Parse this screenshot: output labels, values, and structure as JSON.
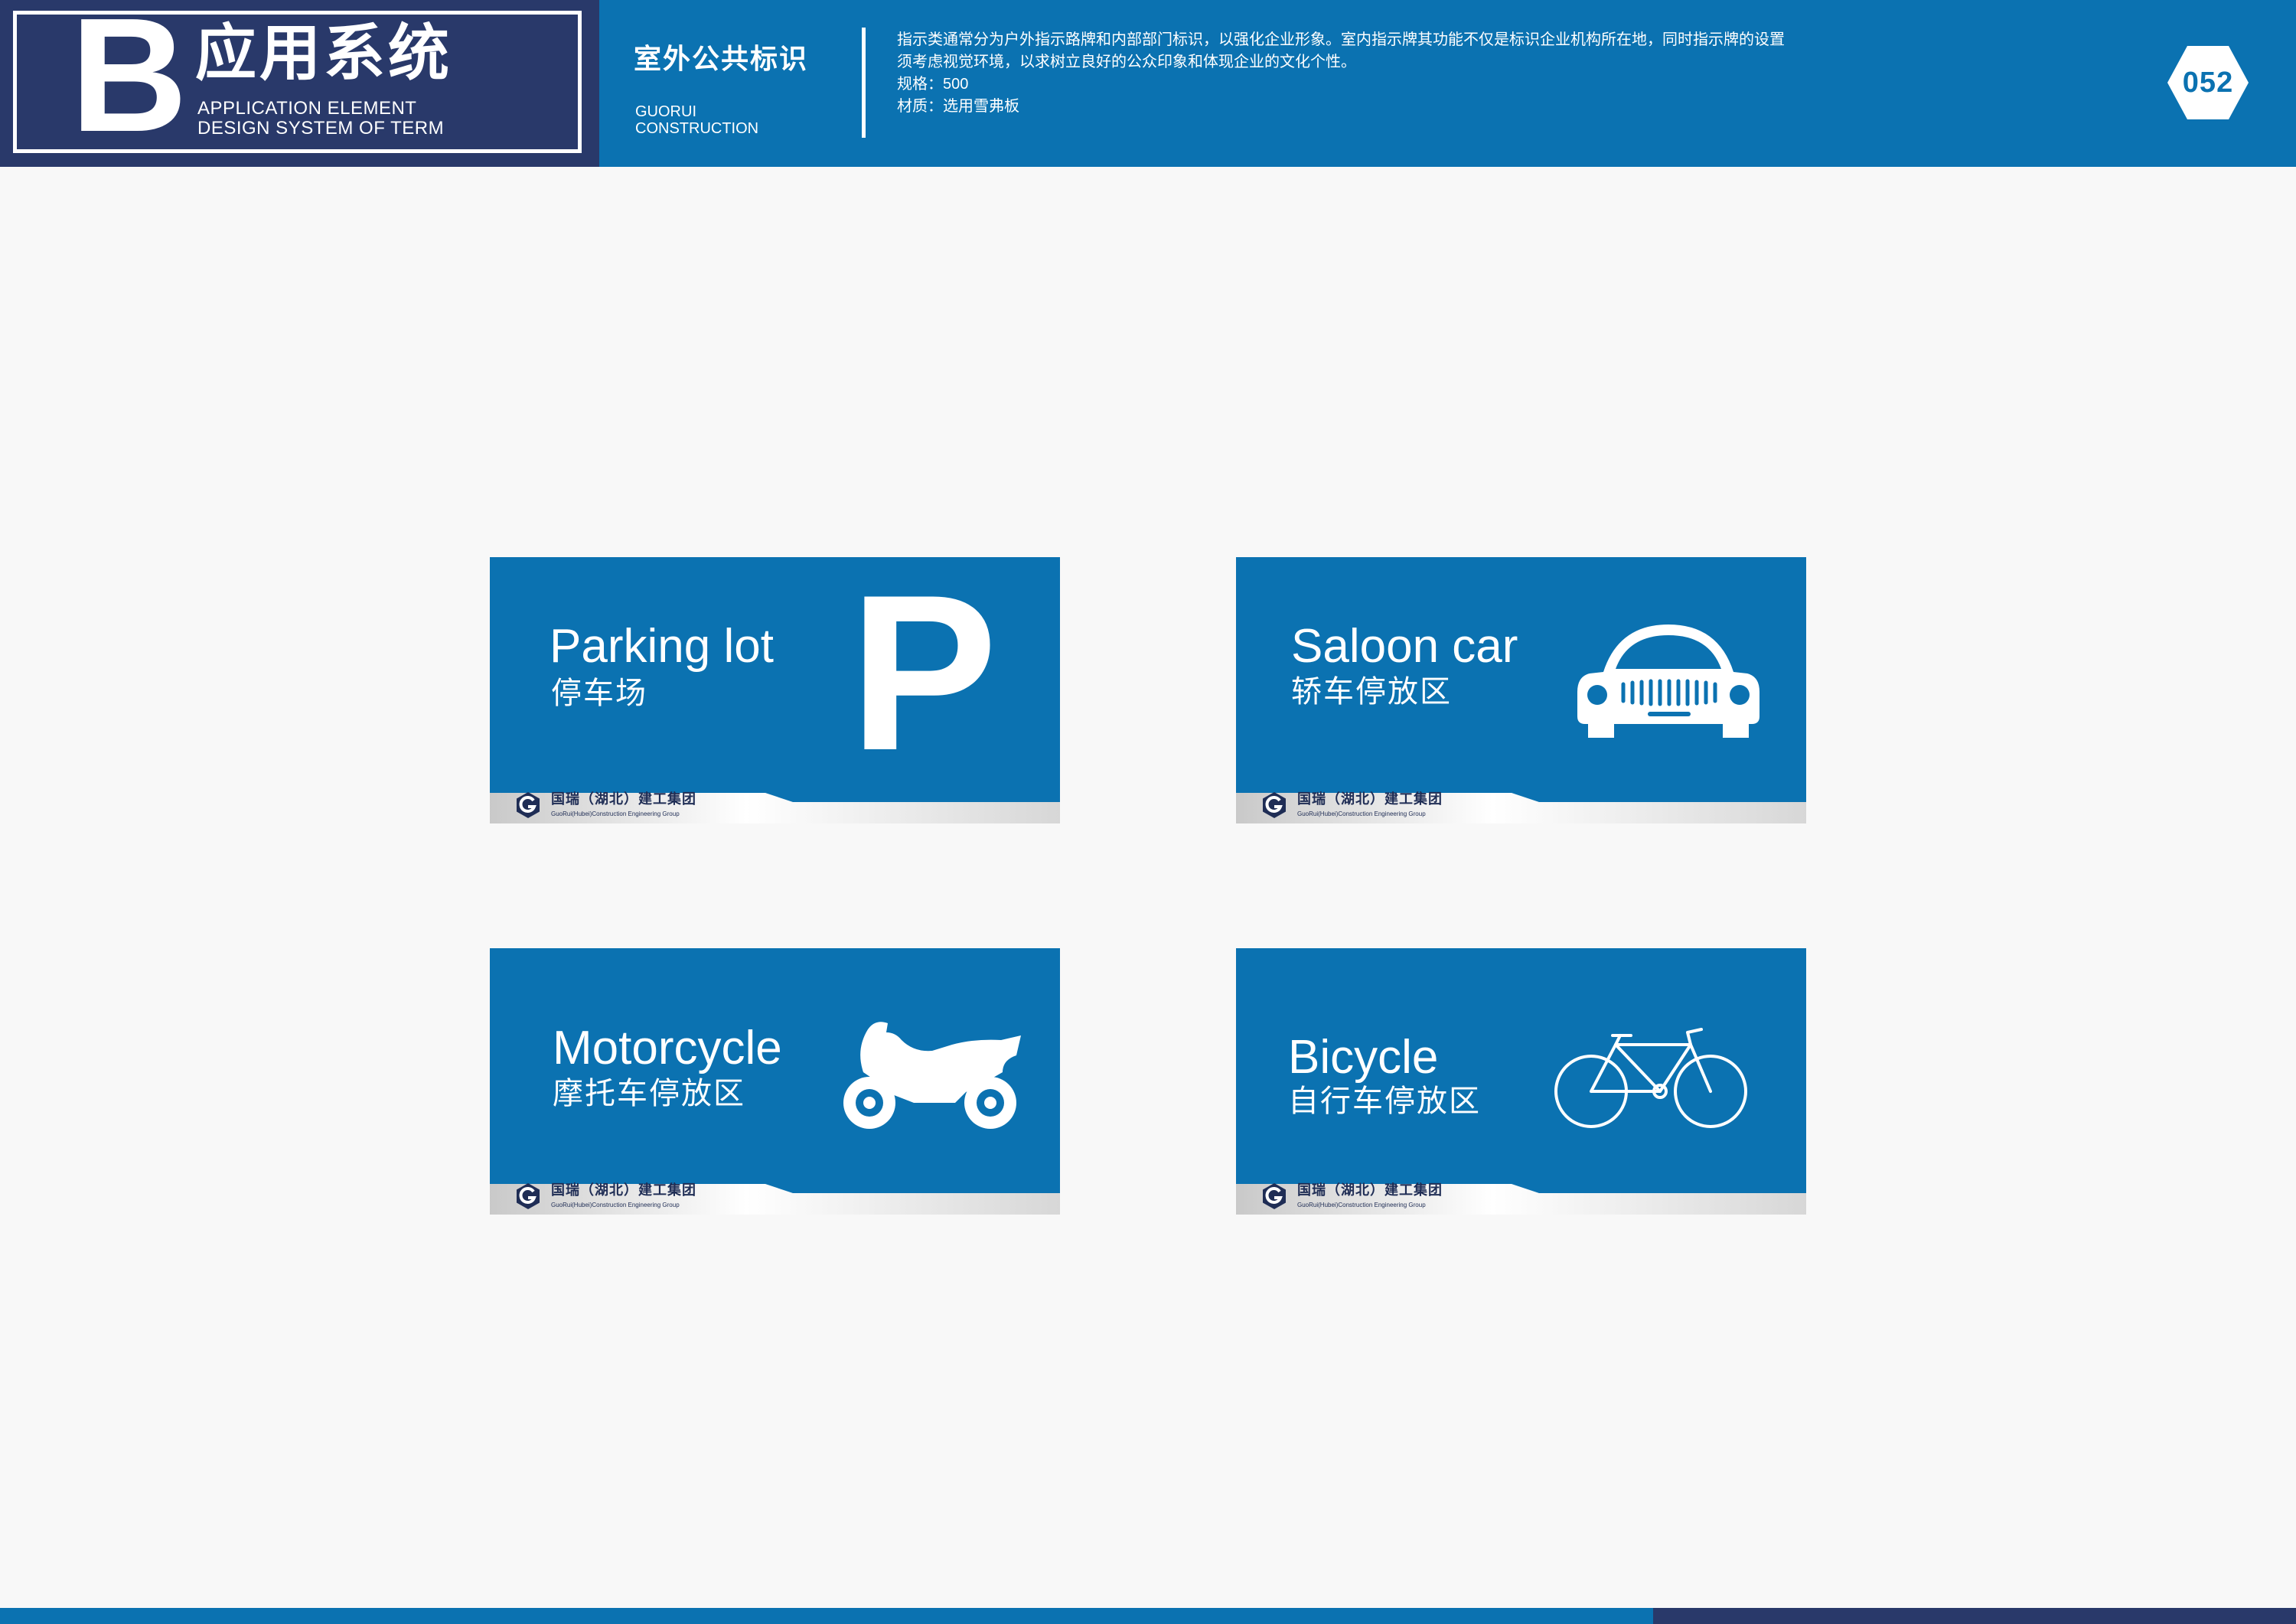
{
  "header": {
    "brand": {
      "letter": "B",
      "title": "应用系统",
      "subtitle_line1": "APPLICATION ELEMENT",
      "subtitle_line2": "DESIGN SYSTEM OF TERM"
    },
    "section": {
      "title": "室外公共标识",
      "subtitle_line1": "GUORUI",
      "subtitle_line2": "CONSTRUCTION"
    },
    "description": {
      "line1": "指示类通常分为户外指示路牌和内部部门标识，以强化企业形象。室内指示牌其功能不仅是标识企业机构所在地，同时指示牌的设置",
      "line2": "须考虑视觉环境，以求树立良好的公众印象和体现企业的文化个性。",
      "line3": "规格：500",
      "line4": "材质：选用雪弗板"
    },
    "page_number": "052"
  },
  "signs": [
    {
      "label_en": "Parking lot",
      "label_cn": "停车场",
      "glyph": "P",
      "icon": "parking-p-icon"
    },
    {
      "label_en": "Saloon car",
      "label_cn": "轿车停放区",
      "icon": "car-front-icon"
    },
    {
      "label_en": "Motorcycle",
      "label_cn": "摩托车停放区",
      "icon": "motorcycle-icon"
    },
    {
      "label_en": "Bicycle",
      "label_cn": "自行车停放区",
      "icon": "bicycle-icon"
    }
  ],
  "company": {
    "name_cn": "国瑞（湖北）建工集团",
    "name_en": "GuoRui(Hubei)Construction Engineering Group",
    "logo_letter": "G"
  },
  "colors": {
    "primary_blue": "#0b72b1",
    "navy": "#29396a",
    "background": "#f8f8f8"
  }
}
